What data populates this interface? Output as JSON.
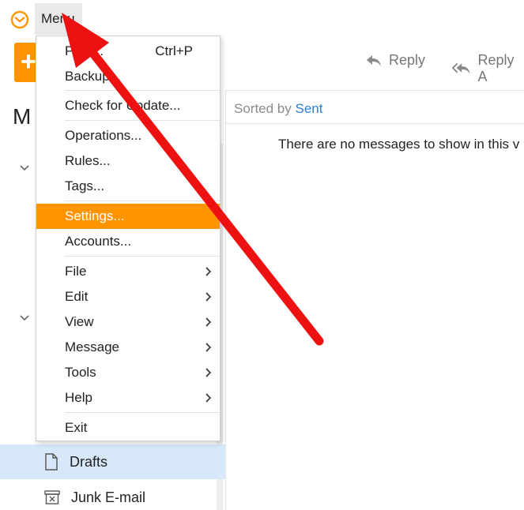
{
  "titlebar": {
    "menu_label": "Menu"
  },
  "toolbar": {
    "new_label": "+",
    "reply_label": "Reply",
    "reply_all_label": "Reply A"
  },
  "sidebar": {
    "title_fragment": "M",
    "folders": [
      {
        "label": "Drafts",
        "icon": "draft-icon",
        "selected": true
      },
      {
        "label": "Junk E-mail",
        "icon": "junk-icon",
        "selected": false
      }
    ]
  },
  "message_list": {
    "sorted_by_prefix": "Sorted by",
    "sorted_by_field": "Sent",
    "empty_text": "There are no messages to show in this v"
  },
  "menu": {
    "items": [
      {
        "label": "Print...",
        "shortcut": "Ctrl+P"
      },
      {
        "label": "Backup..."
      },
      {
        "label": "Check for Update..."
      },
      {
        "label": "Operations..."
      },
      {
        "label": "Rules..."
      },
      {
        "label": "Tags..."
      },
      {
        "label": "Settings...",
        "highlighted": true
      },
      {
        "label": "Accounts..."
      },
      {
        "label": "File",
        "submenu": true
      },
      {
        "label": "Edit",
        "submenu": true
      },
      {
        "label": "View",
        "submenu": true
      },
      {
        "label": "Message",
        "submenu": true
      },
      {
        "label": "Tools",
        "submenu": true
      },
      {
        "label": "Help",
        "submenu": true
      },
      {
        "label": "Exit"
      }
    ]
  },
  "colors": {
    "accent": "#ff9400",
    "link": "#2a7fd0",
    "selected_row": "#d6e8fa",
    "annotation": "#ee1111"
  }
}
